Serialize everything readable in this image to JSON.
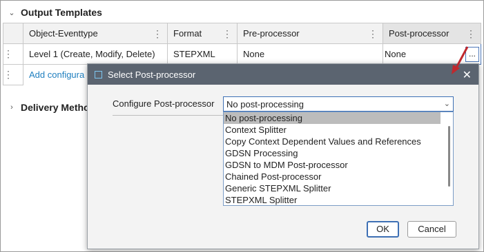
{
  "section": {
    "title": "Output Templates"
  },
  "table": {
    "columns": [
      "Object-Eventtype",
      "Format",
      "Pre-processor",
      "Post-processor"
    ],
    "row": [
      "Level 1 (Create, Modify, Delete)",
      "STEPXML",
      "None",
      "None"
    ],
    "ellipsis": "...",
    "add_link": "Add configura"
  },
  "delivery": {
    "title": "Delivery Metho"
  },
  "dialog": {
    "title": "Select Post-processor",
    "close": "✕",
    "label": "Configure Post-processor",
    "selected_value": "No post-processing",
    "options": [
      "No post-processing",
      "Context Splitter",
      "Copy Context Dependent Values and References",
      "GDSN Processing",
      "GDSN to MDM Post-processor",
      "Chained Post-processor",
      "Generic STEPXML Splitter",
      "STEPXML Splitter"
    ],
    "ok": "OK",
    "cancel": "Cancel"
  },
  "colors": {
    "title_bar": "#5b6470",
    "accent": "#3d6fb4",
    "link": "#1f7fbf",
    "annotation_arrow": "#c0282d"
  }
}
